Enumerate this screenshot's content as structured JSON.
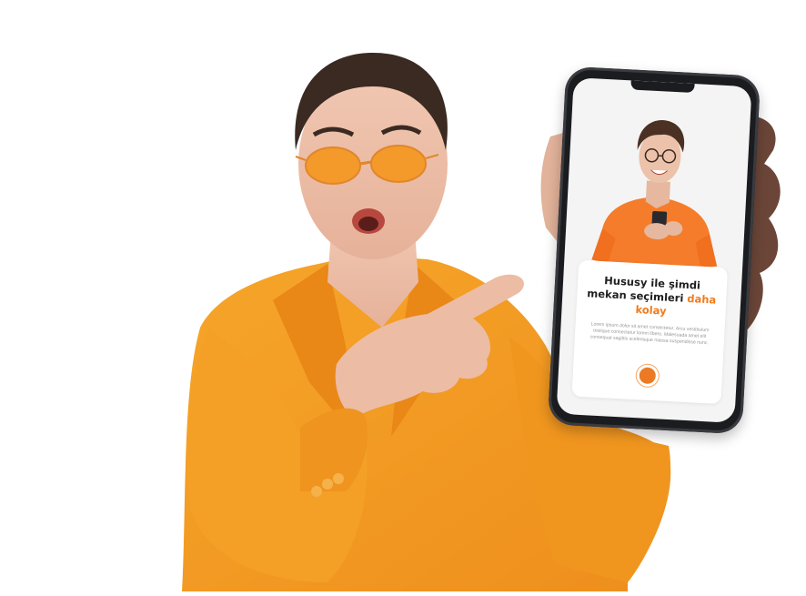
{
  "phone_screen": {
    "headline_part1": "Hususy ile şimdi mekan seçimleri",
    "headline_accent": "daha kolay",
    "body_text": "Lorem ipsum dolor sit amet consectetur. Arcu vestibulum tristique consectetur lorem libero. Malesuada amet elit consequat sagittis scelerisque massa suspendisse nunc."
  },
  "colors": {
    "accent": "#f07c1e",
    "jacket": "#f29a22",
    "tshirt": "#f57c2a",
    "background": "#ffffff"
  }
}
